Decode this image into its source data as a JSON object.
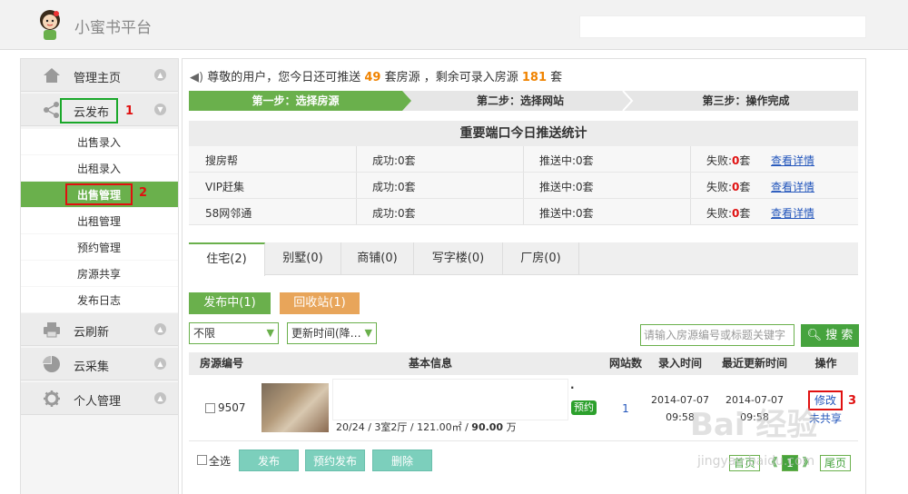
{
  "brand": "小蜜书平台",
  "sidebar": {
    "home": "管理主页",
    "cloud_publish": "云发布",
    "sub_items": [
      "出售录入",
      "出租录入",
      "出售管理",
      "出租管理",
      "预约管理",
      "房源共享",
      "发布日志"
    ],
    "cloud_refresh": "云刷新",
    "cloud_collect": "云采集",
    "personal": "个人管理"
  },
  "annotations": {
    "one": "1",
    "two": "2",
    "three": "3"
  },
  "notice": {
    "prefix": "尊敬的用户，您今日还可推送",
    "push_count": "49",
    "middle": "套房源 ，剩余可录入房源",
    "remain_count": "181",
    "suffix": "套"
  },
  "steps": [
    "第一步：选择房源",
    "第二步：选择网站",
    "第三步：操作完成"
  ],
  "stats": {
    "title": "重要端口今日推送统计",
    "rows": [
      {
        "site": "搜房帮",
        "success": "成功:0套",
        "pushing": "推送中:0套",
        "fail_label": "失败:",
        "fail_num": "0",
        "fail_unit": "套",
        "link": "查看详情"
      },
      {
        "site": "VIP赶集",
        "success": "成功:0套",
        "pushing": "推送中:0套",
        "fail_label": "失败:",
        "fail_num": "0",
        "fail_unit": "套",
        "link": "查看详情"
      },
      {
        "site": "58网邻通",
        "success": "成功:0套",
        "pushing": "推送中:0套",
        "fail_label": "失败:",
        "fail_num": "0",
        "fail_unit": "套",
        "link": "查看详情"
      }
    ]
  },
  "tabs": [
    "住宅(2)",
    "别墅(0)",
    "商铺(0)",
    "写字楼(0)",
    "厂房(0)"
  ],
  "status_tabs": {
    "publishing": "发布中(1)",
    "recycle": "回收站(1)"
  },
  "filters": {
    "type": "不限",
    "sort": "更新时间(降…",
    "keyword_placeholder": "请输入房源编号或标题关键字",
    "search": "搜 索"
  },
  "table": {
    "headers": [
      "房源编号",
      "基本信息",
      "网站数",
      "录入时间",
      "最近更新时间",
      "操作"
    ],
    "row": {
      "id": "9507",
      "dot": "·",
      "reserve_badge": "预约",
      "info": "20/24 / 3室2厅 / 121.00㎡ /",
      "price": "90.00",
      "price_unit": "万",
      "sites": "1",
      "created_date": "2014-07-07",
      "created_time": "09:58",
      "updated_date": "2014-07-07",
      "updated_time": "09:58",
      "edit": "修改",
      "unshared": "未共享"
    }
  },
  "bottom": {
    "select_all": "全选",
    "publish": "发布",
    "schedule": "预约发布",
    "delete": "删除"
  },
  "pager": {
    "first": "首页",
    "prev": "《",
    "page": "1",
    "next": "》",
    "last": "尾页"
  },
  "watermark": {
    "main": "Bai 经验",
    "sub": "jingyan.baidu.com"
  },
  "colors": {
    "accent": "#6ab04c",
    "highlight": "#f08300",
    "annotation": "#e01010",
    "link": "#2255bb"
  }
}
